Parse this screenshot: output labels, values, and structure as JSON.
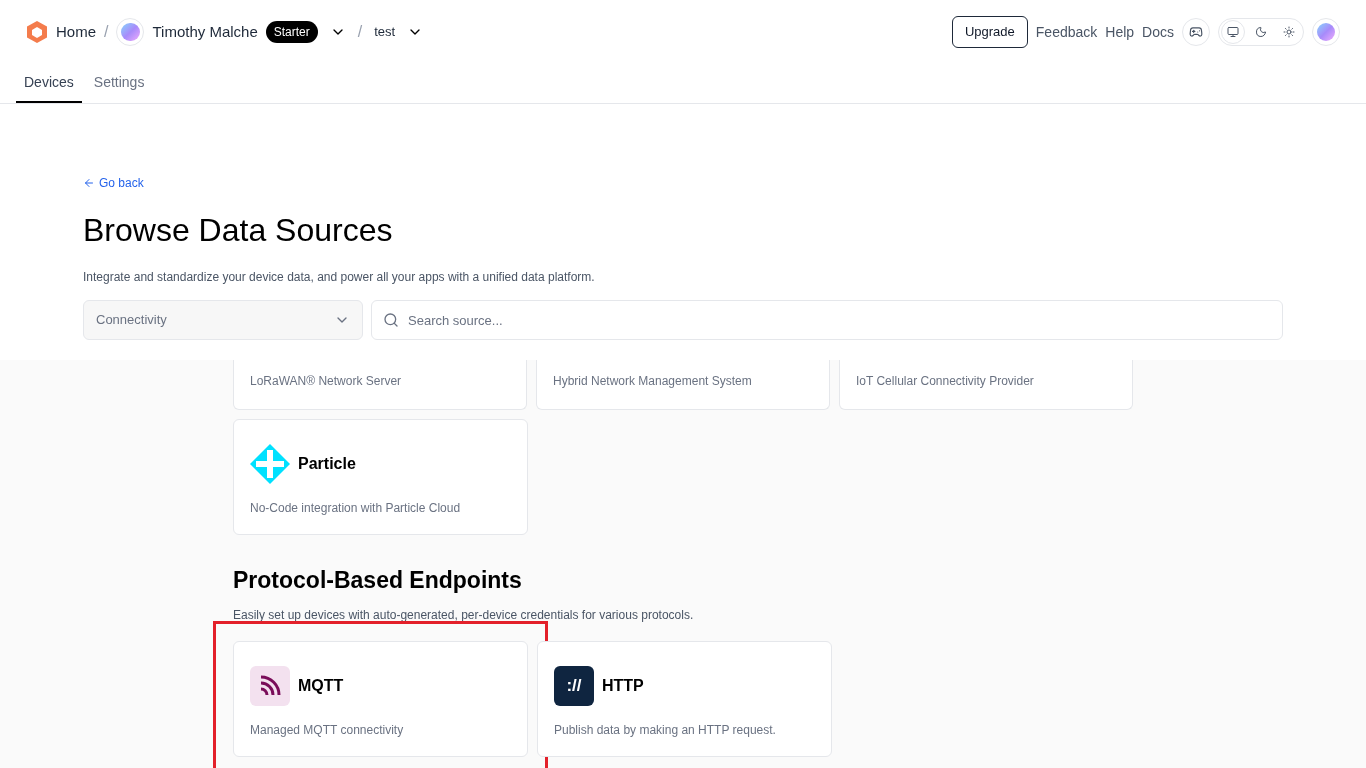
{
  "header": {
    "home": "Home",
    "separator": "/",
    "account": {
      "name": "Timothy Malche",
      "plan": "Starter"
    },
    "project": "test",
    "upgrade": "Upgrade",
    "links": [
      "Feedback",
      "Help",
      "Docs"
    ],
    "theme_options": [
      {
        "kind": "system",
        "selected": true
      },
      {
        "kind": "dark",
        "selected": false
      },
      {
        "kind": "light",
        "selected": false
      }
    ]
  },
  "tabs": [
    {
      "label": "Devices",
      "selected": true
    },
    {
      "label": "Settings",
      "selected": false
    }
  ],
  "back_link": "Go back",
  "title": "Browse Data Sources",
  "subtitle": "Integrate and standardize your device data, and power all your apps with a unified data platform.",
  "category_select": {
    "value": "Connectivity"
  },
  "search": {
    "placeholder": "Search source..."
  },
  "partial_cards": [
    {
      "description": "LoRaWAN® Network Server"
    },
    {
      "description": "Hybrid Network Management System"
    },
    {
      "description": "IoT Cellular Connectivity Provider"
    }
  ],
  "cards": [
    {
      "kind": "particle",
      "name": "Particle",
      "description": "No-Code integration with Particle Cloud",
      "highlighted": false
    }
  ],
  "sections": [
    {
      "title": "Protocol-Based Endpoints",
      "description": "Easily set up devices with auto-generated, per-device credentials for various protocols.",
      "cards": [
        {
          "kind": "mqtt",
          "name": "MQTT",
          "description": "Managed MQTT connectivity",
          "highlighted": true
        },
        {
          "kind": "http",
          "name": "HTTP",
          "icon_text": "://",
          "description": "Publish data by making an HTTP request.",
          "highlighted": false
        }
      ]
    }
  ]
}
